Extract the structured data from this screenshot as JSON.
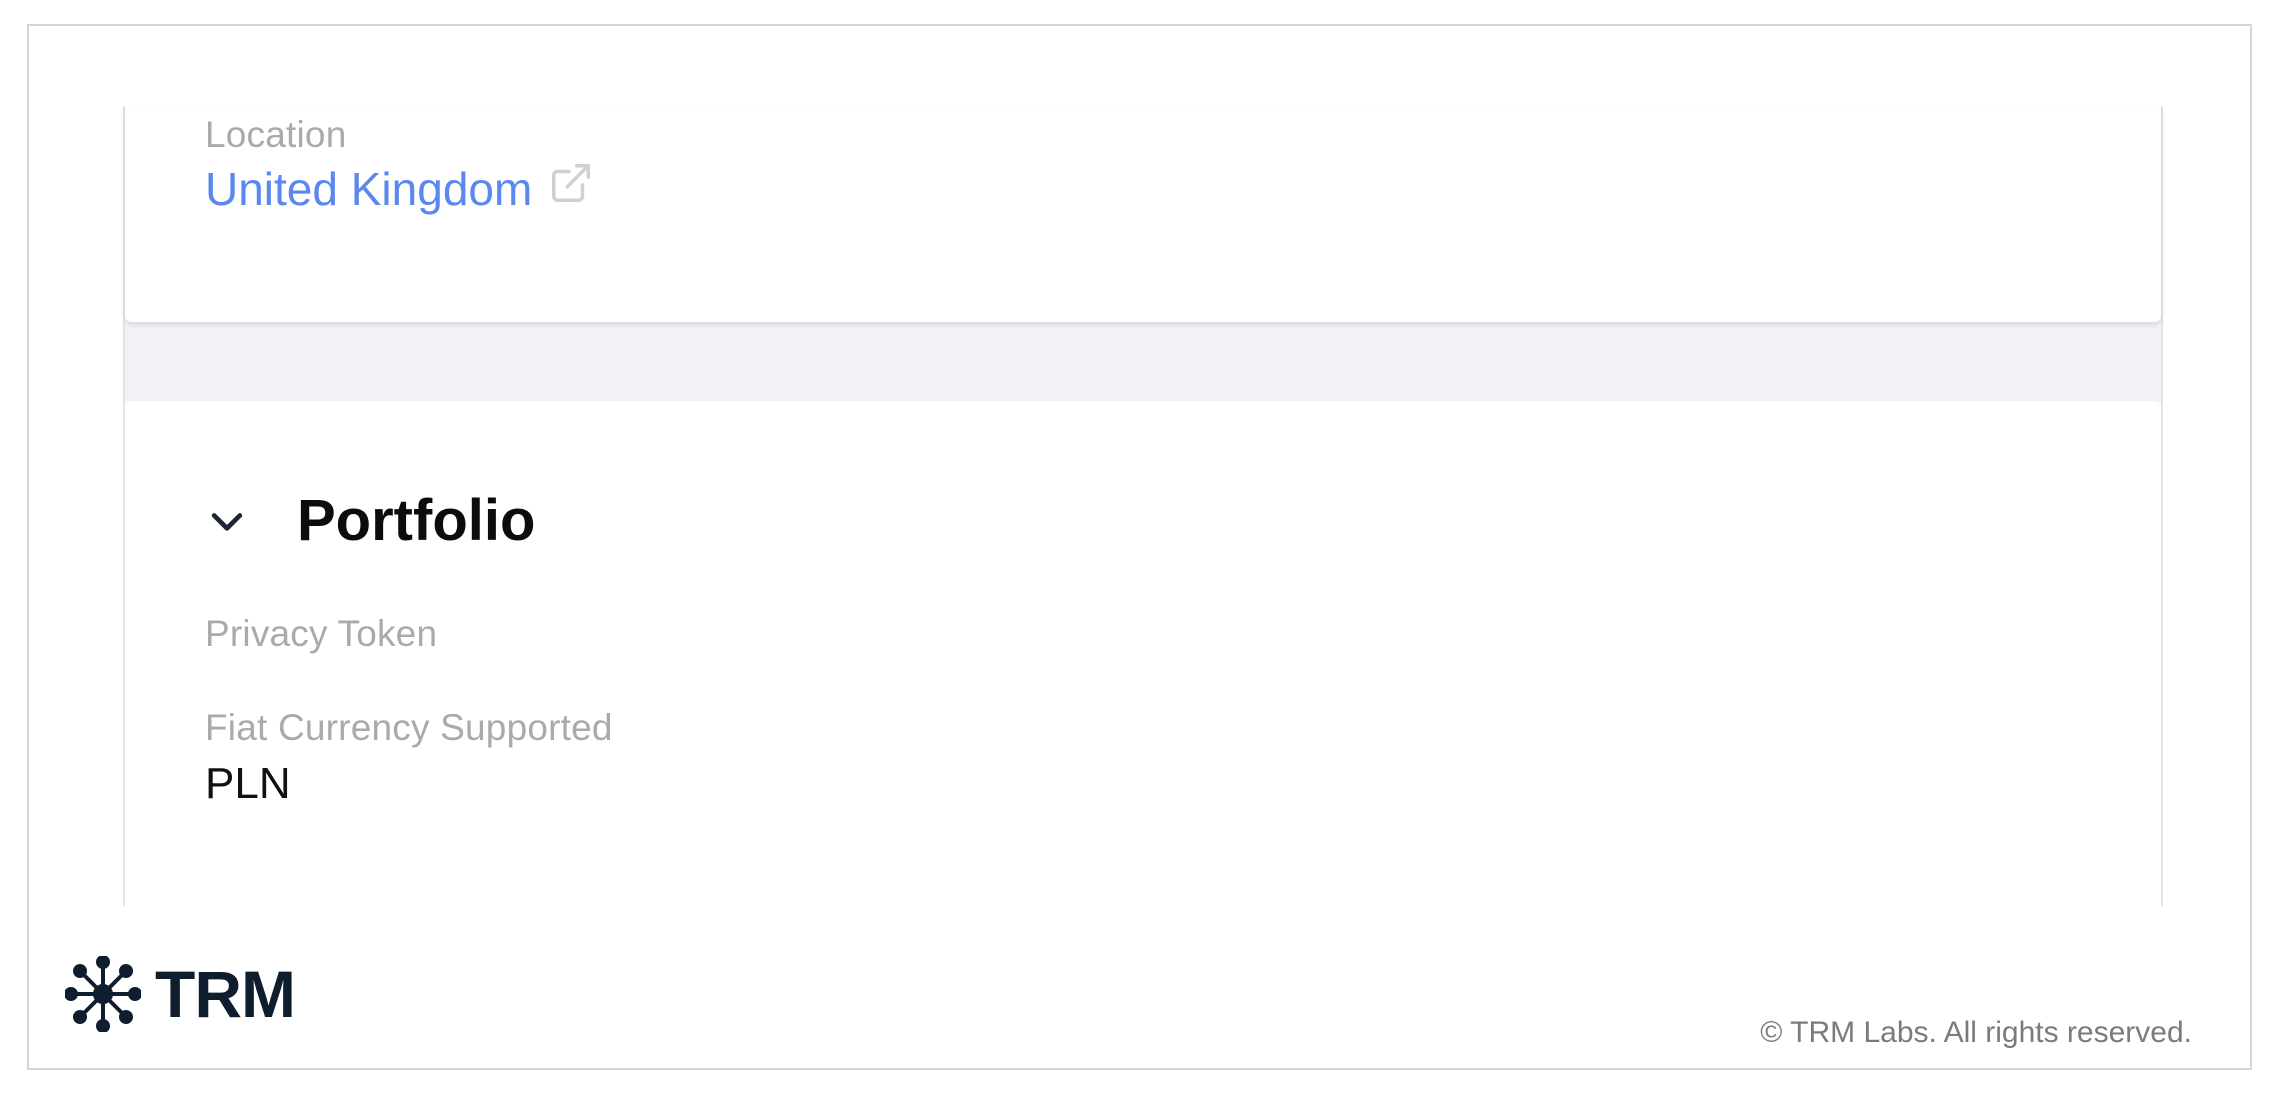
{
  "location": {
    "label": "Location",
    "value": "United Kingdom"
  },
  "portfolio": {
    "title": "Portfolio",
    "fields": [
      {
        "label": "Privacy Token",
        "value": ""
      },
      {
        "label": "Fiat Currency Supported",
        "value": "PLN"
      }
    ]
  },
  "footer": {
    "logo_text": "TRM",
    "copyright": "© TRM Labs. All rights reserved."
  },
  "colors": {
    "link": "#5b87f0",
    "label": "#a9aaae",
    "brand": "#0f1e2e",
    "background": "#f1f2f5"
  },
  "icons": [
    "external-link-icon",
    "chevron-down-icon",
    "trm-logo-icon"
  ]
}
